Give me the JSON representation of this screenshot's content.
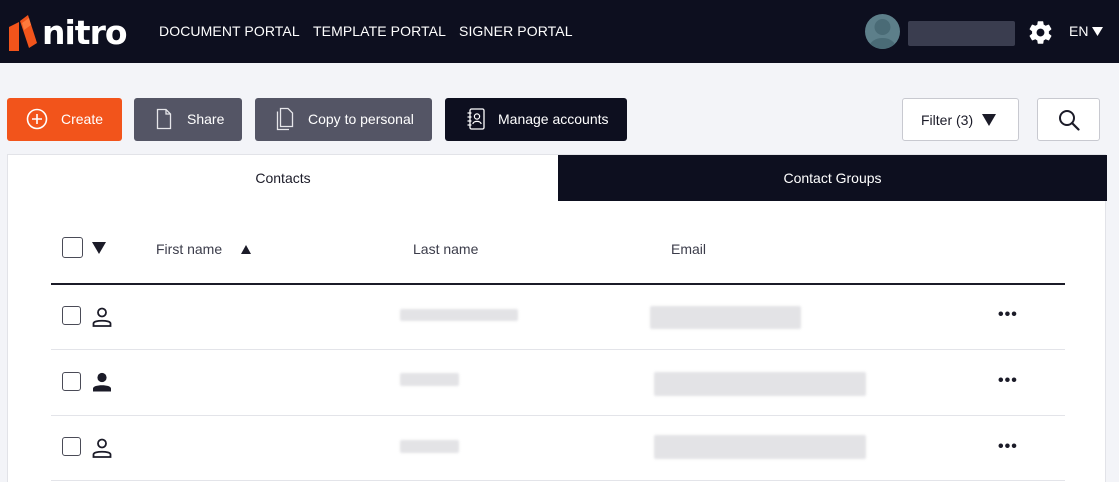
{
  "brand": {
    "name": "nitro",
    "accent": "#f2541b",
    "dark": "#0d0f1f"
  },
  "nav": {
    "links": [
      {
        "label": "DOCUMENT PORTAL"
      },
      {
        "label": "TEMPLATE PORTAL"
      },
      {
        "label": "SIGNER PORTAL"
      }
    ],
    "language": "EN",
    "icons": {
      "settings": "gear-icon",
      "language_dropdown": "caret-down-icon"
    }
  },
  "toolbar": {
    "create_label": "Create",
    "share_label": "Share",
    "copy_label": "Copy to personal",
    "manage_label": "Manage accounts",
    "filter_label": "Filter (3)",
    "icons": {
      "create": "plus-circle-icon",
      "share": "document-icon",
      "copy": "copy-document-icon",
      "manage": "address-book-icon",
      "filter": "caret-down-icon",
      "search": "search-icon"
    }
  },
  "tabs": [
    {
      "label": "Contacts",
      "active": true
    },
    {
      "label": "Contact Groups",
      "active": false
    }
  ],
  "table": {
    "columns": [
      "First name",
      "Last name",
      "Email"
    ],
    "sort": {
      "column": "First name",
      "direction": "ascending"
    },
    "rows": [
      {
        "contact_icon": "person-outline-icon",
        "actions": "•••"
      },
      {
        "contact_icon": "person-filled-icon",
        "actions": "•••"
      },
      {
        "contact_icon": "person-outline-icon",
        "actions": "•••"
      }
    ]
  }
}
